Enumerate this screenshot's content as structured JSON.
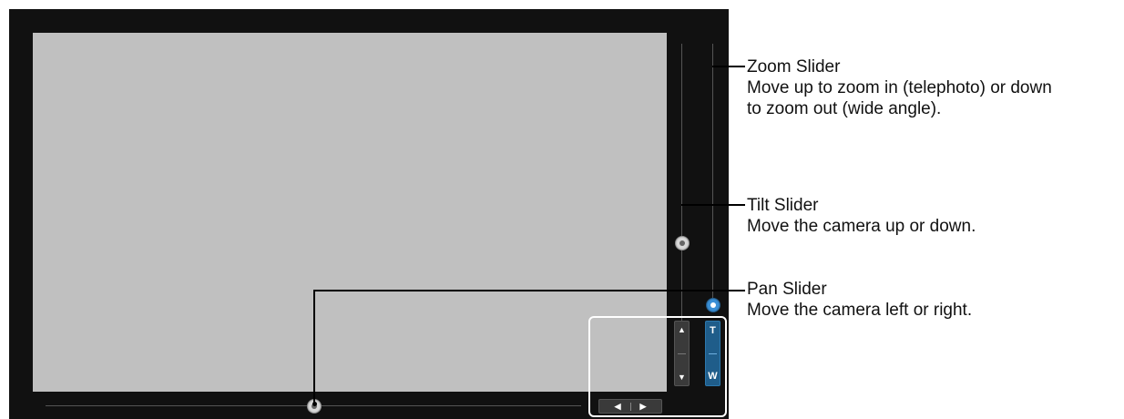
{
  "camera_view": {
    "zoom_buttons": {
      "tele_label": "T",
      "wide_label": "W"
    },
    "tilt_buttons": {
      "up_glyph": "▲",
      "down_glyph": "▼"
    },
    "pan_buttons": {
      "left_glyph": "◀",
      "right_glyph": "▶"
    }
  },
  "callouts": [
    {
      "title": "Zoom Slider",
      "description_line1": "Move up to zoom in (telephoto) or down",
      "description_line2": "to zoom out (wide angle)."
    },
    {
      "title": "Tilt Slider",
      "description_line1": "Move the camera up or down."
    },
    {
      "title": "Pan Slider",
      "description_line1": "Move the camera left or right."
    }
  ],
  "colors": {
    "panel": "#111111",
    "video": "#c0c0c0",
    "zoom_accent": "#3a8fd6"
  }
}
